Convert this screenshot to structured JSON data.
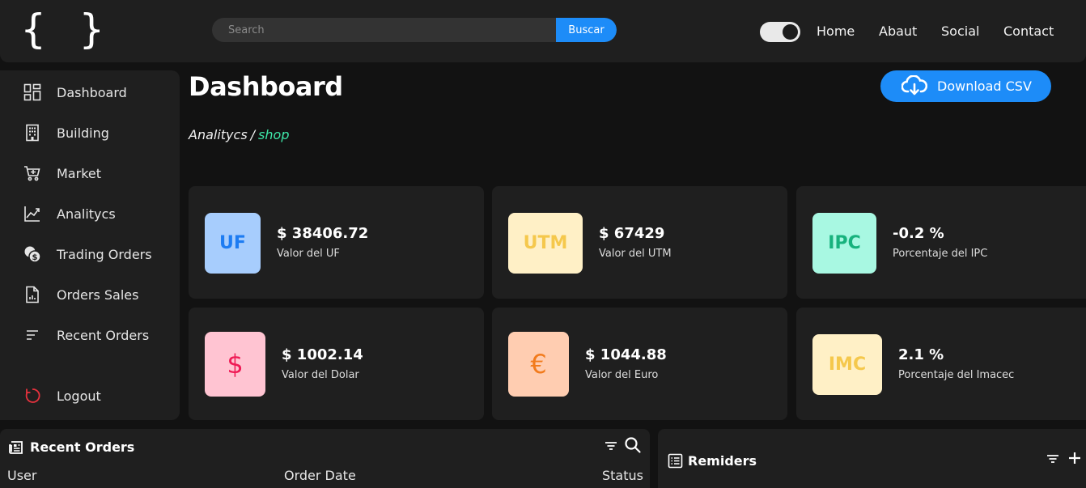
{
  "header": {
    "logo_text": "{ }",
    "search_placeholder": "Search",
    "search_button": "Buscar",
    "theme_toggle_on": true,
    "nav": [
      "Home",
      "Abaut",
      "Social",
      "Contact"
    ]
  },
  "sidebar": {
    "items": [
      {
        "label": "Dashboard",
        "icon": "dashboard-icon"
      },
      {
        "label": "Building",
        "icon": "building-icon"
      },
      {
        "label": "Market",
        "icon": "cart-icon"
      },
      {
        "label": "Analitycs",
        "icon": "chart-line-icon"
      },
      {
        "label": "Trading Orders",
        "icon": "coins-icon"
      },
      {
        "label": "Orders Sales",
        "icon": "report-icon"
      },
      {
        "label": "Recent Orders",
        "icon": "sort-icon"
      }
    ],
    "logout": {
      "label": "Logout",
      "icon": "power-icon"
    }
  },
  "page": {
    "title": "Dashboard",
    "breadcrumb": {
      "section": "Analitycs",
      "separator": "/",
      "current": "shop"
    },
    "download_label": "Download CSV"
  },
  "cards": [
    {
      "badge": "UF",
      "value": "$ 38406.72",
      "label": "Valor del UF",
      "badge_bg": "#a7cdfd",
      "badge_fg": "#1d7cf2"
    },
    {
      "badge": "UTM",
      "value": "$ 67429",
      "label": "Valor del UTM",
      "badge_bg": "#fff0c6",
      "badge_fg": "#f5c84c"
    },
    {
      "badge": "IPC",
      "value": "-0.2 %",
      "label": "Porcentaje del IPC",
      "badge_bg": "#a8f8e2",
      "badge_fg": "#17b27d"
    },
    {
      "badge": "$",
      "value": "$ 1002.14",
      "label": "Valor del Dolar",
      "badge_bg": "#ffc4d2",
      "badge_fg": "#ef1a55"
    },
    {
      "badge": "€",
      "value": "$ 1044.88",
      "label": "Valor del Euro",
      "badge_bg": "#ffcdb1",
      "badge_fg": "#f27b1c"
    },
    {
      "badge": "IMC",
      "value": "2.1 %",
      "label": "Porcentaje del Imacec",
      "badge_bg": "#fff0c6",
      "badge_fg": "#f5c84c"
    }
  ],
  "recent_orders": {
    "title": "Recent Orders",
    "columns": [
      "User",
      "Order Date",
      "Status"
    ]
  },
  "reminders": {
    "title": "Remiders"
  },
  "colors": {
    "accent": "#1d8cf8",
    "breadcrumb_current": "#3ee6a8",
    "logout_icon": "#e8323e"
  }
}
